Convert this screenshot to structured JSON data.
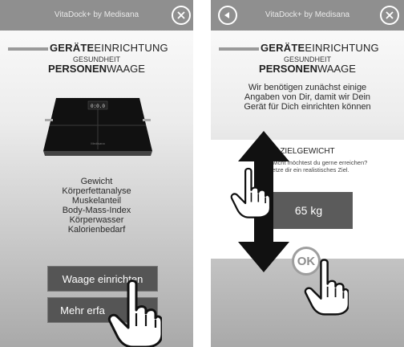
{
  "app": {
    "title": "VitaDock+ by Medisana"
  },
  "header": {
    "line1_bold": "GERÄTE",
    "line1_rest": "EINRICHTUNG",
    "line2": "GESUNDHEIT",
    "line3_bold": "PERSONEN",
    "line3_rest": "WAAGE"
  },
  "screen1": {
    "scale_display": "0:0.0",
    "scale_brand": "Medisana",
    "features": [
      "Gewicht",
      "Körperfettanalyse",
      "Muskelanteil",
      "Body-Mass-Index",
      "Körperwasser",
      "Kalorienbedarf"
    ],
    "primary_button": "Waage einrichten",
    "secondary_button": "Mehr erfa"
  },
  "screen2": {
    "intro": [
      "Wir benötigen zunächst einige",
      "Angaben von Dir, damit wir Dein",
      "Gerät für Dich einrichten können"
    ],
    "panel_title": "ZIELGEWICHT",
    "panel_desc": [
      "Welc     ewicht möchtest du gerne erreichen?",
      "     etze dir ein realistisches Ziel."
    ],
    "value": "65 kg",
    "ok_label": "OK"
  },
  "colors": {
    "topbar": "#8f8f8f",
    "button": "#555555",
    "value_box": "#5b5b5b",
    "ok_ring": "#9e9e9e"
  },
  "icons": [
    "close-icon",
    "back-icon",
    "hand-pointer-icon",
    "vertical-double-arrow-icon"
  ]
}
